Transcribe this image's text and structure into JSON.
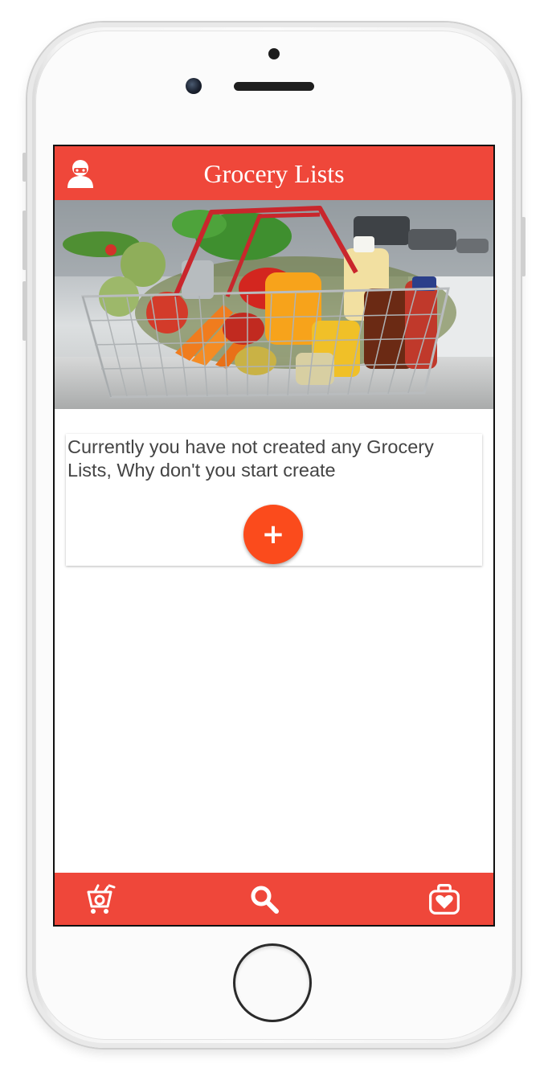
{
  "app": {
    "title": "Grocery Lists"
  },
  "empty_state": {
    "message": "Currently you have not created any Grocery Lists, Why don't you start create",
    "add_button_label": "+"
  },
  "hero_image": {
    "alt": "Grocery basket with vegetables and bottles"
  },
  "bottom_nav": {
    "items": [
      {
        "icon": "cart-icon"
      },
      {
        "icon": "search-icon"
      },
      {
        "icon": "heart-bag-icon"
      }
    ]
  },
  "colors": {
    "primary": "#ef473a",
    "accent": "#fb4b1c",
    "text": "#444444",
    "white": "#ffffff"
  }
}
